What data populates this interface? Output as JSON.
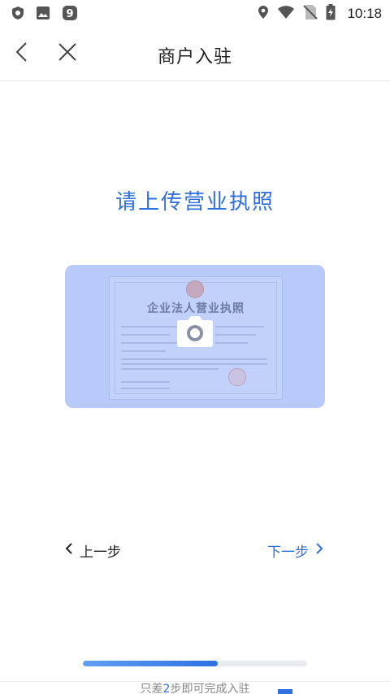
{
  "status_bar": {
    "time": "10:18",
    "icons_left": [
      "shield-icon",
      "image-icon",
      "app-9-icon"
    ],
    "icons_right": [
      "location-icon",
      "wifi-icon",
      "no-sim-icon",
      "battery-charging-icon"
    ]
  },
  "header": {
    "back_icon": "chevron-left-icon",
    "close_icon": "close-icon",
    "title": "商户入驻"
  },
  "upload": {
    "prompt": "请上传营业执照",
    "sample_title": "企业法人营业执照",
    "camera_icon": "camera-icon"
  },
  "nav": {
    "prev_label": "上一步",
    "next_label": "下一步"
  },
  "progress": {
    "fraction": 0.6,
    "hint_before": "只差",
    "hint_number": "2",
    "hint_after": "步即可完成入驻"
  },
  "colors": {
    "accent": "#2f6fe0",
    "card_bg": "#cfdcfb"
  }
}
